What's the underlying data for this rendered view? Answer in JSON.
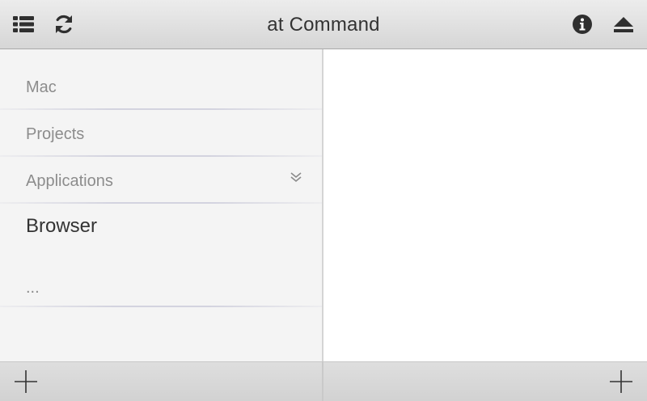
{
  "window": {
    "title": "at Command"
  },
  "toolbar": {
    "list_icon": "list-icon",
    "refresh_icon": "refresh-icon",
    "info_icon": "info-icon",
    "eject_icon": "eject-icon"
  },
  "sidebar": {
    "items": [
      {
        "label": "Mac"
      },
      {
        "label": "Projects"
      },
      {
        "label": "Applications",
        "icon": "double-chevron-down-icon"
      },
      {
        "label": "Browser",
        "selected": true
      },
      {
        "label": "..."
      }
    ]
  },
  "bottombar": {
    "left_add_icon": "plus-icon",
    "right_add_icon": "plus-icon"
  },
  "colors": {
    "titlebar_top": "#ececec",
    "titlebar_bottom": "#d6d6d6",
    "sidebar_bg": "#f4f4f4",
    "muted_text": "#8c8c8c",
    "primary_text": "#333333"
  }
}
